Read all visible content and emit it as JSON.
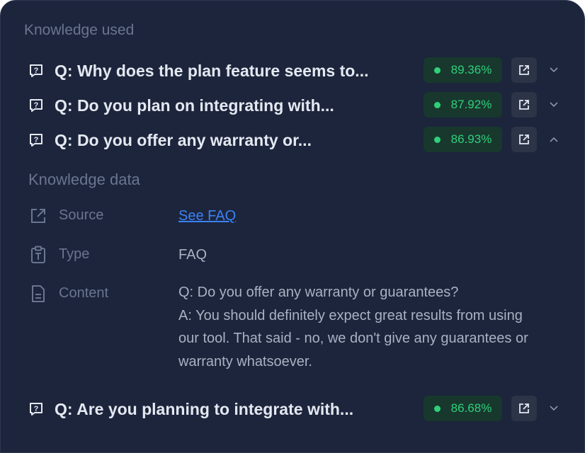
{
  "panel": {
    "title": "Knowledge used"
  },
  "knowledge_items": [
    {
      "question": "Q: Why does the plan feature seems to...",
      "score": "89.36%",
      "expanded": false
    },
    {
      "question": "Q: Do you plan on integrating with...",
      "score": "87.92%",
      "expanded": false
    },
    {
      "question": "Q: Do you offer any warranty or...",
      "score": "86.93%",
      "expanded": true
    },
    {
      "question": "Q: Are you planning to integrate with...",
      "score": "86.68%",
      "expanded": false
    }
  ],
  "knowledge_data": {
    "title": "Knowledge data",
    "source_label": "Source",
    "source_value": "See FAQ",
    "type_label": "Type",
    "type_value": "FAQ",
    "content_label": "Content",
    "content_lines": [
      "Q: Do you offer any warranty or guarantees?",
      "A: You should definitely expect great results from using",
      "our tool. That said - no, we don't give any guarantees or",
      "warranty whatsoever."
    ]
  },
  "colors": {
    "panel_bg": "#1c253b",
    "score_green": "#2fd07a",
    "link_blue": "#3b82f6"
  },
  "icons": [
    "question-box-icon",
    "external-link-icon",
    "chevron-down-icon",
    "chevron-up-icon",
    "source-link-icon",
    "clipboard-type-icon",
    "document-icon"
  ]
}
